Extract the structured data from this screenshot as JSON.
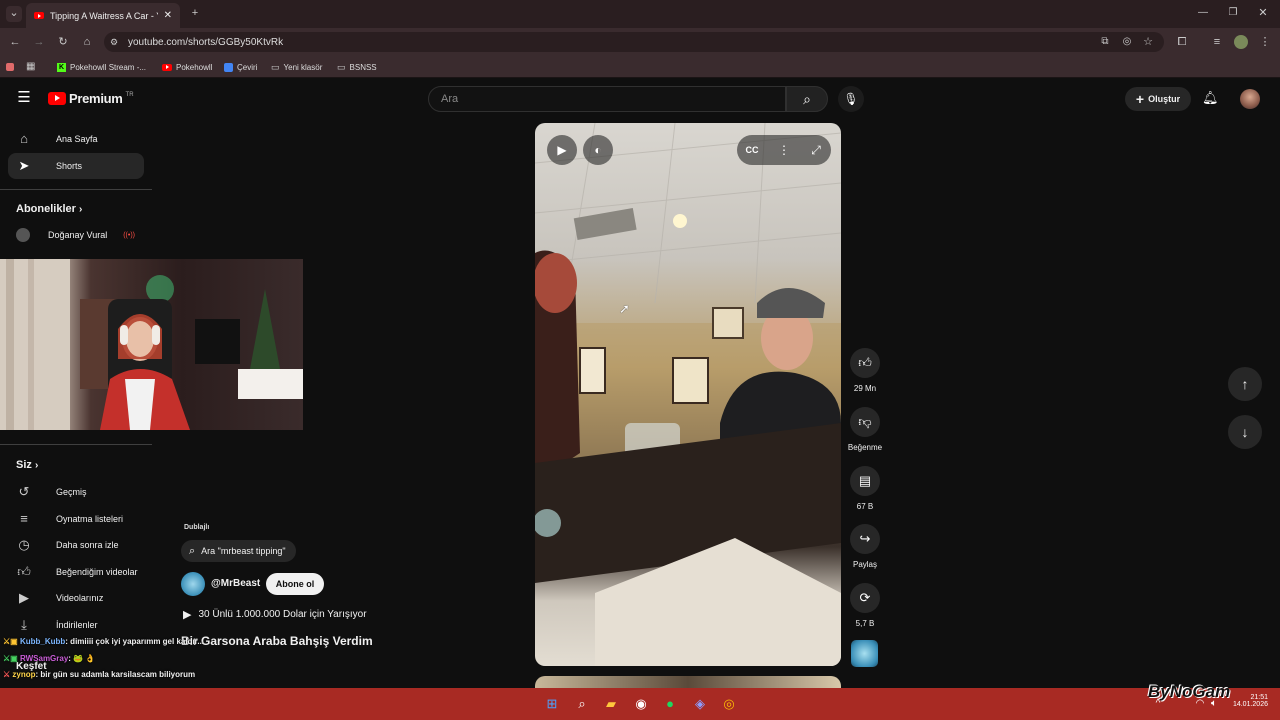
{
  "browser": {
    "tab_title": "Tipping A Waitress A Car - YouT",
    "url": "youtube.com/shorts/GGBy50KtvRk",
    "bookmarks": [
      "Pokehowll Stream -...",
      "Pokehowll",
      "Çeviri",
      "Yeni klasör",
      "BSNSS"
    ]
  },
  "youtube": {
    "logo_text": "Premium",
    "logo_sup": "TR",
    "search_placeholder": "Ara",
    "create_label": "Oluştur",
    "sidebar": {
      "top": [
        {
          "label": "Ana Sayfa",
          "icon": "home-icon"
        },
        {
          "label": "Shorts",
          "icon": "shorts-icon"
        }
      ],
      "subs_header": "Abonelikler",
      "subs": [
        {
          "label": "Doğanay Vural",
          "live": "((•))"
        }
      ],
      "you_header": "Siz",
      "you": [
        {
          "label": "Geçmiş"
        },
        {
          "label": "Oynatma listeleri"
        },
        {
          "label": "Daha sonra izle"
        },
        {
          "label": "Beğendiğim videolar"
        },
        {
          "label": "Videolarınız"
        },
        {
          "label": "İndirilenler"
        }
      ],
      "explore_header": "Keşfet"
    },
    "short": {
      "dub_label": "Dublajlı",
      "search_chip": "Ara \"mrbeast tipping\"",
      "channel": "@MrBeast",
      "subscribe": "Abone ol",
      "playlist": "30 Ünlü 1.000.000 Dolar için Yarışıyor",
      "title": "Bir Garsona Araba Bahşiş Verdim"
    },
    "actions": {
      "likes": "29 Mn",
      "dislike": "Beğenme",
      "comments": "67 B",
      "share": "Paylaş",
      "remix": "5,7 B"
    }
  },
  "chat": [
    {
      "user": "Kubb_Kubb",
      "message": ": dimiiii çok iyi yaparımm gel kaldır..."
    },
    {
      "user": "RWSamGray",
      "message": ": 🐸 👌"
    },
    {
      "user": "zynop",
      "message": ": bir gün su adamla karsilascam biliyorum"
    }
  ],
  "taskbar": {
    "watermark": "ByNoGam",
    "time": "21:51",
    "date": "14.01.2026"
  },
  "colors": {
    "yt_red": "#ff0000",
    "taskbar": "#a82a23",
    "bg": "#0f0f0f"
  }
}
